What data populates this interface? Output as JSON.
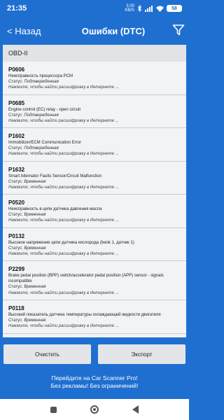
{
  "status_bar": {
    "time": "21:35",
    "speed_top": "3.00",
    "speed_bottom": "KB/S",
    "battery": "58"
  },
  "app_bar": {
    "back_label": "< Назад",
    "title": "Ошибки (DTC)",
    "filter_icon": "filter-icon"
  },
  "section_title": "OBD-II",
  "status_prefix": "Статус: ",
  "codes": [
    {
      "code": "P0606",
      "description": "Неисправность процессора PCM",
      "status": "Подтвержденная",
      "hint": "Нажмите, чтобы найти расшифровку в Интернете ..."
    },
    {
      "code": "P0685",
      "description": "Engine control (EC) relay - open circuit",
      "status": "Подтвержденная",
      "hint": "Нажмите, чтобы найти расшифровку в Интернете ..."
    },
    {
      "code": "P1602",
      "description": "Immobilizer/ECM Communication Error",
      "status": "Подтвержденная",
      "hint": "Нажмите, чтобы найти расшифровку в Интернете ..."
    },
    {
      "code": "P1632",
      "description": "Smart Alternator Faults Sensor/Circuit Malfunction",
      "status": "Временная",
      "hint": "Нажмите, чтобы найти расшифровку в Интернете ..."
    },
    {
      "code": "P0520",
      "description": "Неисправность в цепи датчика давления масла",
      "status": "Временная",
      "hint": "Нажмите, чтобы найти расшифровку в Интернете ..."
    },
    {
      "code": "P0132",
      "description": "Высокое напряжение цепи датчика кислорода (bank 1, датчик 1)",
      "status": "Временная",
      "hint": "Нажмите, чтобы найти расшифровку в Интернете ..."
    },
    {
      "code": "P2299",
      "description": "Brake pedal position (BPP) switch/accelerator pedal position (APP) sensor - signals incompatible",
      "status": "Временная",
      "hint": "Нажмите, чтобы найти расшифровку в Интернете ..."
    },
    {
      "code": "P0118",
      "description": "Высокий показатель датчика температуры охлаждающей жидкости двигателя",
      "status": "Временная",
      "hint": "Нажмите, чтобы найти расшифровку в Интернете ..."
    }
  ],
  "buttons": {
    "clear": "Очистить",
    "export": "Экспорт"
  },
  "promo": {
    "line1": "Перейдите на Car Scanner Pro!",
    "line2": "Без рекламы! Без ограничений!"
  },
  "colors": {
    "primary": "#1f6fd1",
    "list_bg": "#f2f3f5",
    "header_bg": "#e1e3e7",
    "button_bg": "#e4e5e8"
  }
}
